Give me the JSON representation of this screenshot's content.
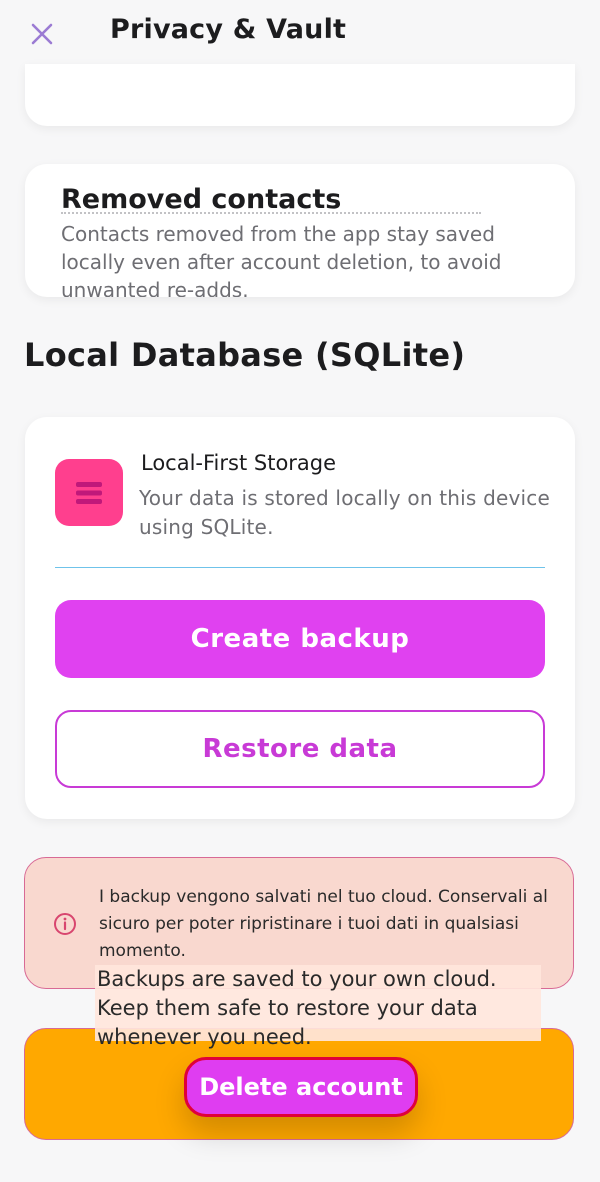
{
  "header": {
    "title": "Privacy & Vault",
    "close_icon": "close-icon",
    "accent": "#9b7bd3"
  },
  "removed_contacts": {
    "title": "Removed contacts",
    "description": "Contacts removed from the app stay saved locally even after account deletion, to avoid unwanted re-adds."
  },
  "local_db": {
    "section_title": "Local Database (SQLite)",
    "storage_title": "Local-First Storage",
    "storage_description": "Your data is stored locally on this device using SQLite.",
    "storage_icon": "database-icon",
    "create_backup_label": "Create backup",
    "restore_label": "Restore data"
  },
  "notice": {
    "icon": "info-icon",
    "text": "I backup vengono salvati nel tuo cloud. Conservali al sicuro per poter ripristinare i tuoi dati in qualsiasi momento.",
    "translation": "Backups are saved to your own cloud. Keep them safe to restore your data whenever you need."
  },
  "danger": {
    "delete_label": "Delete account"
  },
  "colors": {
    "primary_button": "#e041f0",
    "outline_button": "#c83ad6",
    "notice_bg": "#f9d8cf",
    "danger_bg": "#ffa800",
    "icon_bg": "#ff3f8e"
  }
}
